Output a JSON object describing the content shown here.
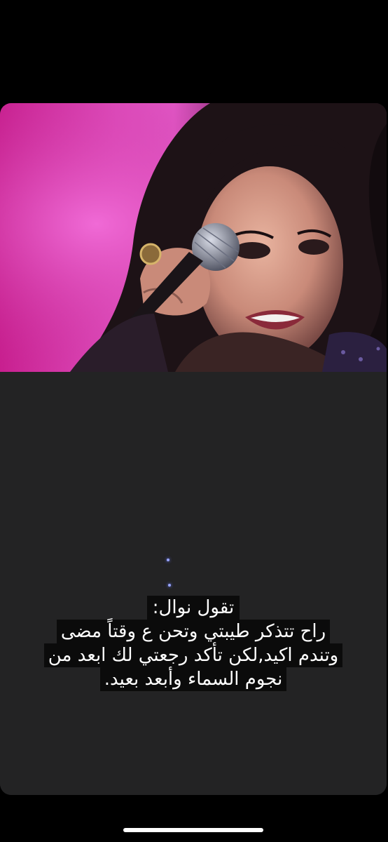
{
  "story": {
    "image_alt": "singer-performing-photo",
    "caption": {
      "title": "تقول نوال:",
      "lines": [
        "راح تتذكر طيبتي وتحن ع وقتاً مضى",
        "وتندم اكيد,لكن تأكد رجعتي لك ابعد من",
        "نجوم السماء وأبعد بعيد."
      ]
    }
  },
  "colors": {
    "background": "#000000",
    "card": "#232324",
    "caption_bg": "#0b0b0b",
    "caption_text": "#ffffff",
    "photo_accent": "#e04fc0"
  }
}
